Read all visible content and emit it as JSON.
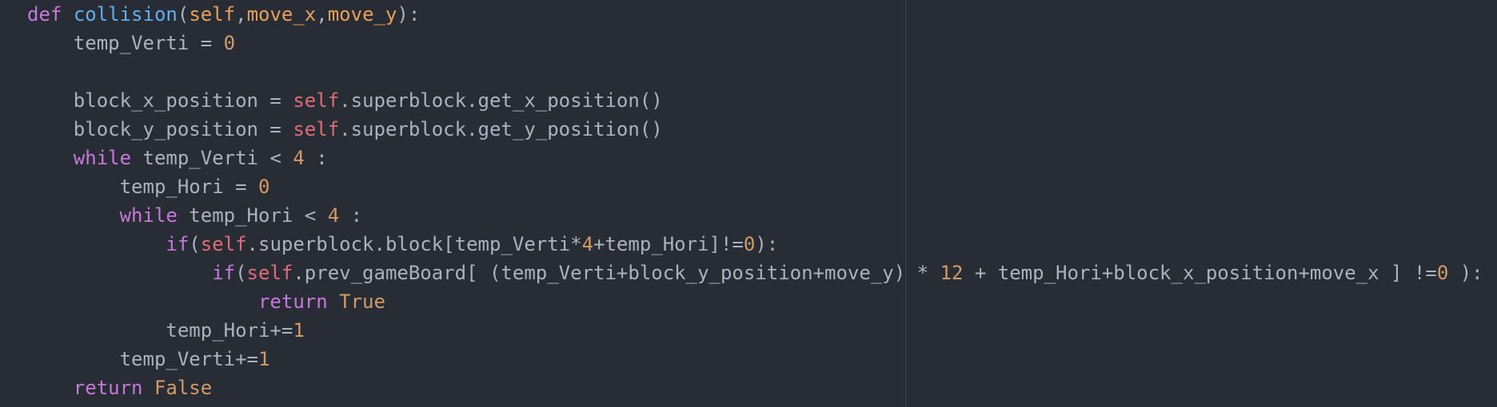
{
  "editor": {
    "colors": {
      "background": "#282c34",
      "default_text": "#abb2bf",
      "keyword": "#c678dd",
      "function": "#61afef",
      "parameter": "#e5a05a",
      "number": "#d19a66",
      "self": "#e06c75",
      "ruler": "#3b4048"
    },
    "lines": [
      [
        [
          "kw",
          "def"
        ],
        [
          "tx",
          " "
        ],
        [
          "fn",
          "collision"
        ],
        [
          "tx",
          "("
        ],
        [
          "prm",
          "self"
        ],
        [
          "tx",
          ","
        ],
        [
          "prm",
          "move_x"
        ],
        [
          "tx",
          ","
        ],
        [
          "prm",
          "move_y"
        ],
        [
          "tx",
          "):"
        ]
      ],
      [
        [
          "tx",
          "    temp_Verti = "
        ],
        [
          "num",
          "0"
        ]
      ],
      [],
      [
        [
          "tx",
          "    block_x_position = "
        ],
        [
          "slf",
          "self"
        ],
        [
          "tx",
          ".superblock.get_x_position()"
        ]
      ],
      [
        [
          "tx",
          "    block_y_position = "
        ],
        [
          "slf",
          "self"
        ],
        [
          "tx",
          ".superblock.get_y_position()"
        ]
      ],
      [
        [
          "tx",
          "    "
        ],
        [
          "kw",
          "while"
        ],
        [
          "tx",
          " temp_Verti < "
        ],
        [
          "num",
          "4"
        ],
        [
          "tx",
          " :"
        ]
      ],
      [
        [
          "tx",
          "        temp_Hori = "
        ],
        [
          "num",
          "0"
        ]
      ],
      [
        [
          "tx",
          "        "
        ],
        [
          "kw",
          "while"
        ],
        [
          "tx",
          " temp_Hori < "
        ],
        [
          "num",
          "4"
        ],
        [
          "tx",
          " :"
        ]
      ],
      [
        [
          "tx",
          "            "
        ],
        [
          "kw",
          "if"
        ],
        [
          "tx",
          "("
        ],
        [
          "slf",
          "self"
        ],
        [
          "tx",
          ".superblock.block[temp_Verti*"
        ],
        [
          "num",
          "4"
        ],
        [
          "tx",
          "+temp_Hori]!="
        ],
        [
          "num",
          "0"
        ],
        [
          "tx",
          "):"
        ]
      ],
      [
        [
          "tx",
          "                "
        ],
        [
          "kw",
          "if"
        ],
        [
          "tx",
          "("
        ],
        [
          "slf",
          "self"
        ],
        [
          "tx",
          ".prev_gameBoard[ (temp_Verti+block_y_position+move_y) * "
        ],
        [
          "num",
          "12"
        ],
        [
          "tx",
          " + temp_Hori+block_x_position+move_x ] !="
        ],
        [
          "num",
          "0"
        ],
        [
          "tx",
          " ):"
        ]
      ],
      [
        [
          "tx",
          "                    "
        ],
        [
          "kw",
          "return"
        ],
        [
          "tx",
          " "
        ],
        [
          "bi",
          "True"
        ]
      ],
      [
        [
          "tx",
          "            temp_Hori+="
        ],
        [
          "num",
          "1"
        ]
      ],
      [
        [
          "tx",
          "        temp_Verti+="
        ],
        [
          "num",
          "1"
        ]
      ],
      [
        [
          "tx",
          "    "
        ],
        [
          "kw",
          "return"
        ],
        [
          "tx",
          " "
        ],
        [
          "bi",
          "False"
        ]
      ]
    ]
  }
}
